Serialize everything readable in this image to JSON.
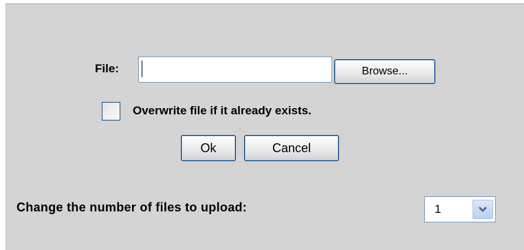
{
  "upload_form": {
    "file_label": "File:",
    "file_value": "",
    "browse_label": "Browse...",
    "overwrite_label": "Overwrite file if it already exists.",
    "overwrite_checked": false,
    "ok_label": "Ok",
    "cancel_label": "Cancel",
    "change_count_label": "Change the number of files to upload:",
    "file_count_selected": "1"
  },
  "icons": {
    "dropdown": "chevron-down-icon"
  },
  "colors": {
    "panel_background": "#d4d4d4",
    "button_border": "#003c74",
    "dropdown_arrow": "#4d6185"
  }
}
